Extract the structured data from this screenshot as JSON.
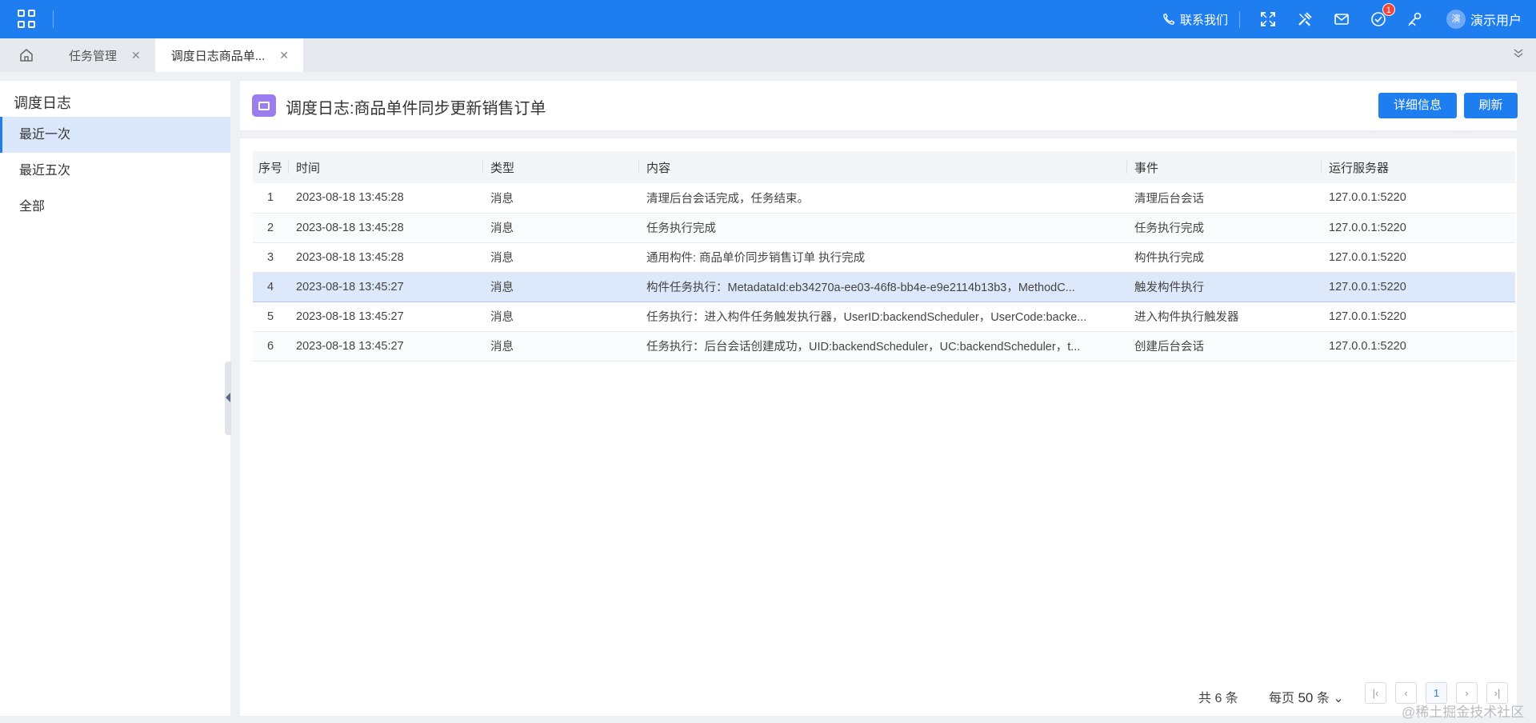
{
  "topbar": {
    "contact_label": "联系我们",
    "notification_count": "1",
    "user_avatar_text": "演",
    "user_name": "演示用户"
  },
  "tabs": [
    {
      "label": "任务管理"
    },
    {
      "label": "调度日志商品单..."
    }
  ],
  "sidebar": {
    "title": "调度日志",
    "items": [
      {
        "label": "最近一次"
      },
      {
        "label": "最近五次"
      },
      {
        "label": "全部"
      }
    ]
  },
  "header": {
    "title": "调度日志:商品单件同步更新销售订单",
    "detail_button": "详细信息",
    "refresh_button": "刷新"
  },
  "table": {
    "columns": [
      "序号",
      "时间",
      "类型",
      "内容",
      "事件",
      "运行服务器"
    ],
    "rows": [
      {
        "idx": "1",
        "time": "2023-08-18 13:45:28",
        "type": "消息",
        "content": "清理后台会话完成，任务结束。",
        "event": "清理后台会话",
        "server": "127.0.0.1:5220"
      },
      {
        "idx": "2",
        "time": "2023-08-18 13:45:28",
        "type": "消息",
        "content": "任务执行完成",
        "event": "任务执行完成",
        "server": "127.0.0.1:5220"
      },
      {
        "idx": "3",
        "time": "2023-08-18 13:45:28",
        "type": "消息",
        "content": "通用构件: 商品单价同步销售订单 执行完成",
        "event": "构件执行完成",
        "server": "127.0.0.1:5220"
      },
      {
        "idx": "4",
        "time": "2023-08-18 13:45:27",
        "type": "消息",
        "content": "构件任务执行：MetadataId:eb34270a-ee03-46f8-bb4e-e9e2114b13b3，MethodC...",
        "event": "触发构件执行",
        "server": "127.0.0.1:5220"
      },
      {
        "idx": "5",
        "time": "2023-08-18 13:45:27",
        "type": "消息",
        "content": "任务执行：进入构件任务触发执行器，UserID:backendScheduler，UserCode:backe...",
        "event": "进入构件执行触发器",
        "server": "127.0.0.1:5220"
      },
      {
        "idx": "6",
        "time": "2023-08-18 13:45:27",
        "type": "消息",
        "content": "任务执行：后台会话创建成功，UID:backendScheduler，UC:backendScheduler，t...",
        "event": "创建后台会话",
        "server": "127.0.0.1:5220"
      }
    ]
  },
  "pagination": {
    "total_text": "共 6 条",
    "page_size_prefix": "每页",
    "page_size": "50",
    "page_size_suffix": "条",
    "current_page": "1"
  },
  "watermark": "@稀土掘金技术社区"
}
